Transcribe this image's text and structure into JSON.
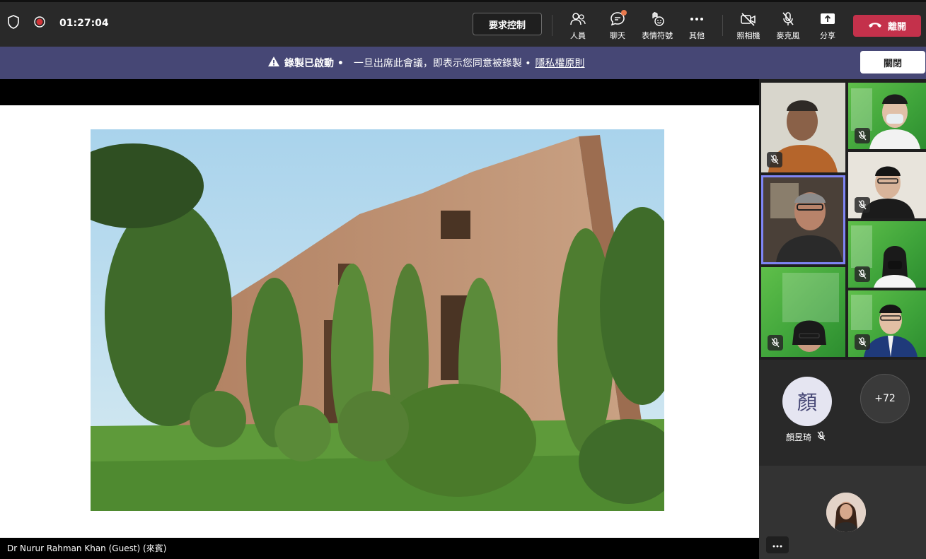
{
  "topbar": {
    "timer": "01:27:04",
    "request_control_label": "要求控制",
    "tools": [
      {
        "label": "人員",
        "icon": "people-icon"
      },
      {
        "label": "聊天",
        "icon": "chat-icon"
      },
      {
        "label": "表情符號",
        "icon": "reactions-icon"
      },
      {
        "label": "其他",
        "icon": "more-icon"
      },
      {
        "label": "照相機",
        "icon": "camera-off-icon"
      },
      {
        "label": "麥克風",
        "icon": "mic-off-icon"
      },
      {
        "label": "分享",
        "icon": "share-icon"
      }
    ],
    "leave_label": "離開",
    "leave_color": "#c4314b"
  },
  "banner": {
    "recording_text": "錄製已啟動 •",
    "consent_text": "一旦出席此會議，即表示您同意被錄製 •",
    "privacy_link": "隱私權原則",
    "close_label": "關閉",
    "background": "#464775"
  },
  "stage": {
    "presenter_label": "Dr Nurur Rahman Khan (Guest) (來賓)"
  },
  "panel": {
    "audio_participant": {
      "initial": "顏",
      "name": "顏昱琦"
    },
    "overflow_count": "+72"
  }
}
